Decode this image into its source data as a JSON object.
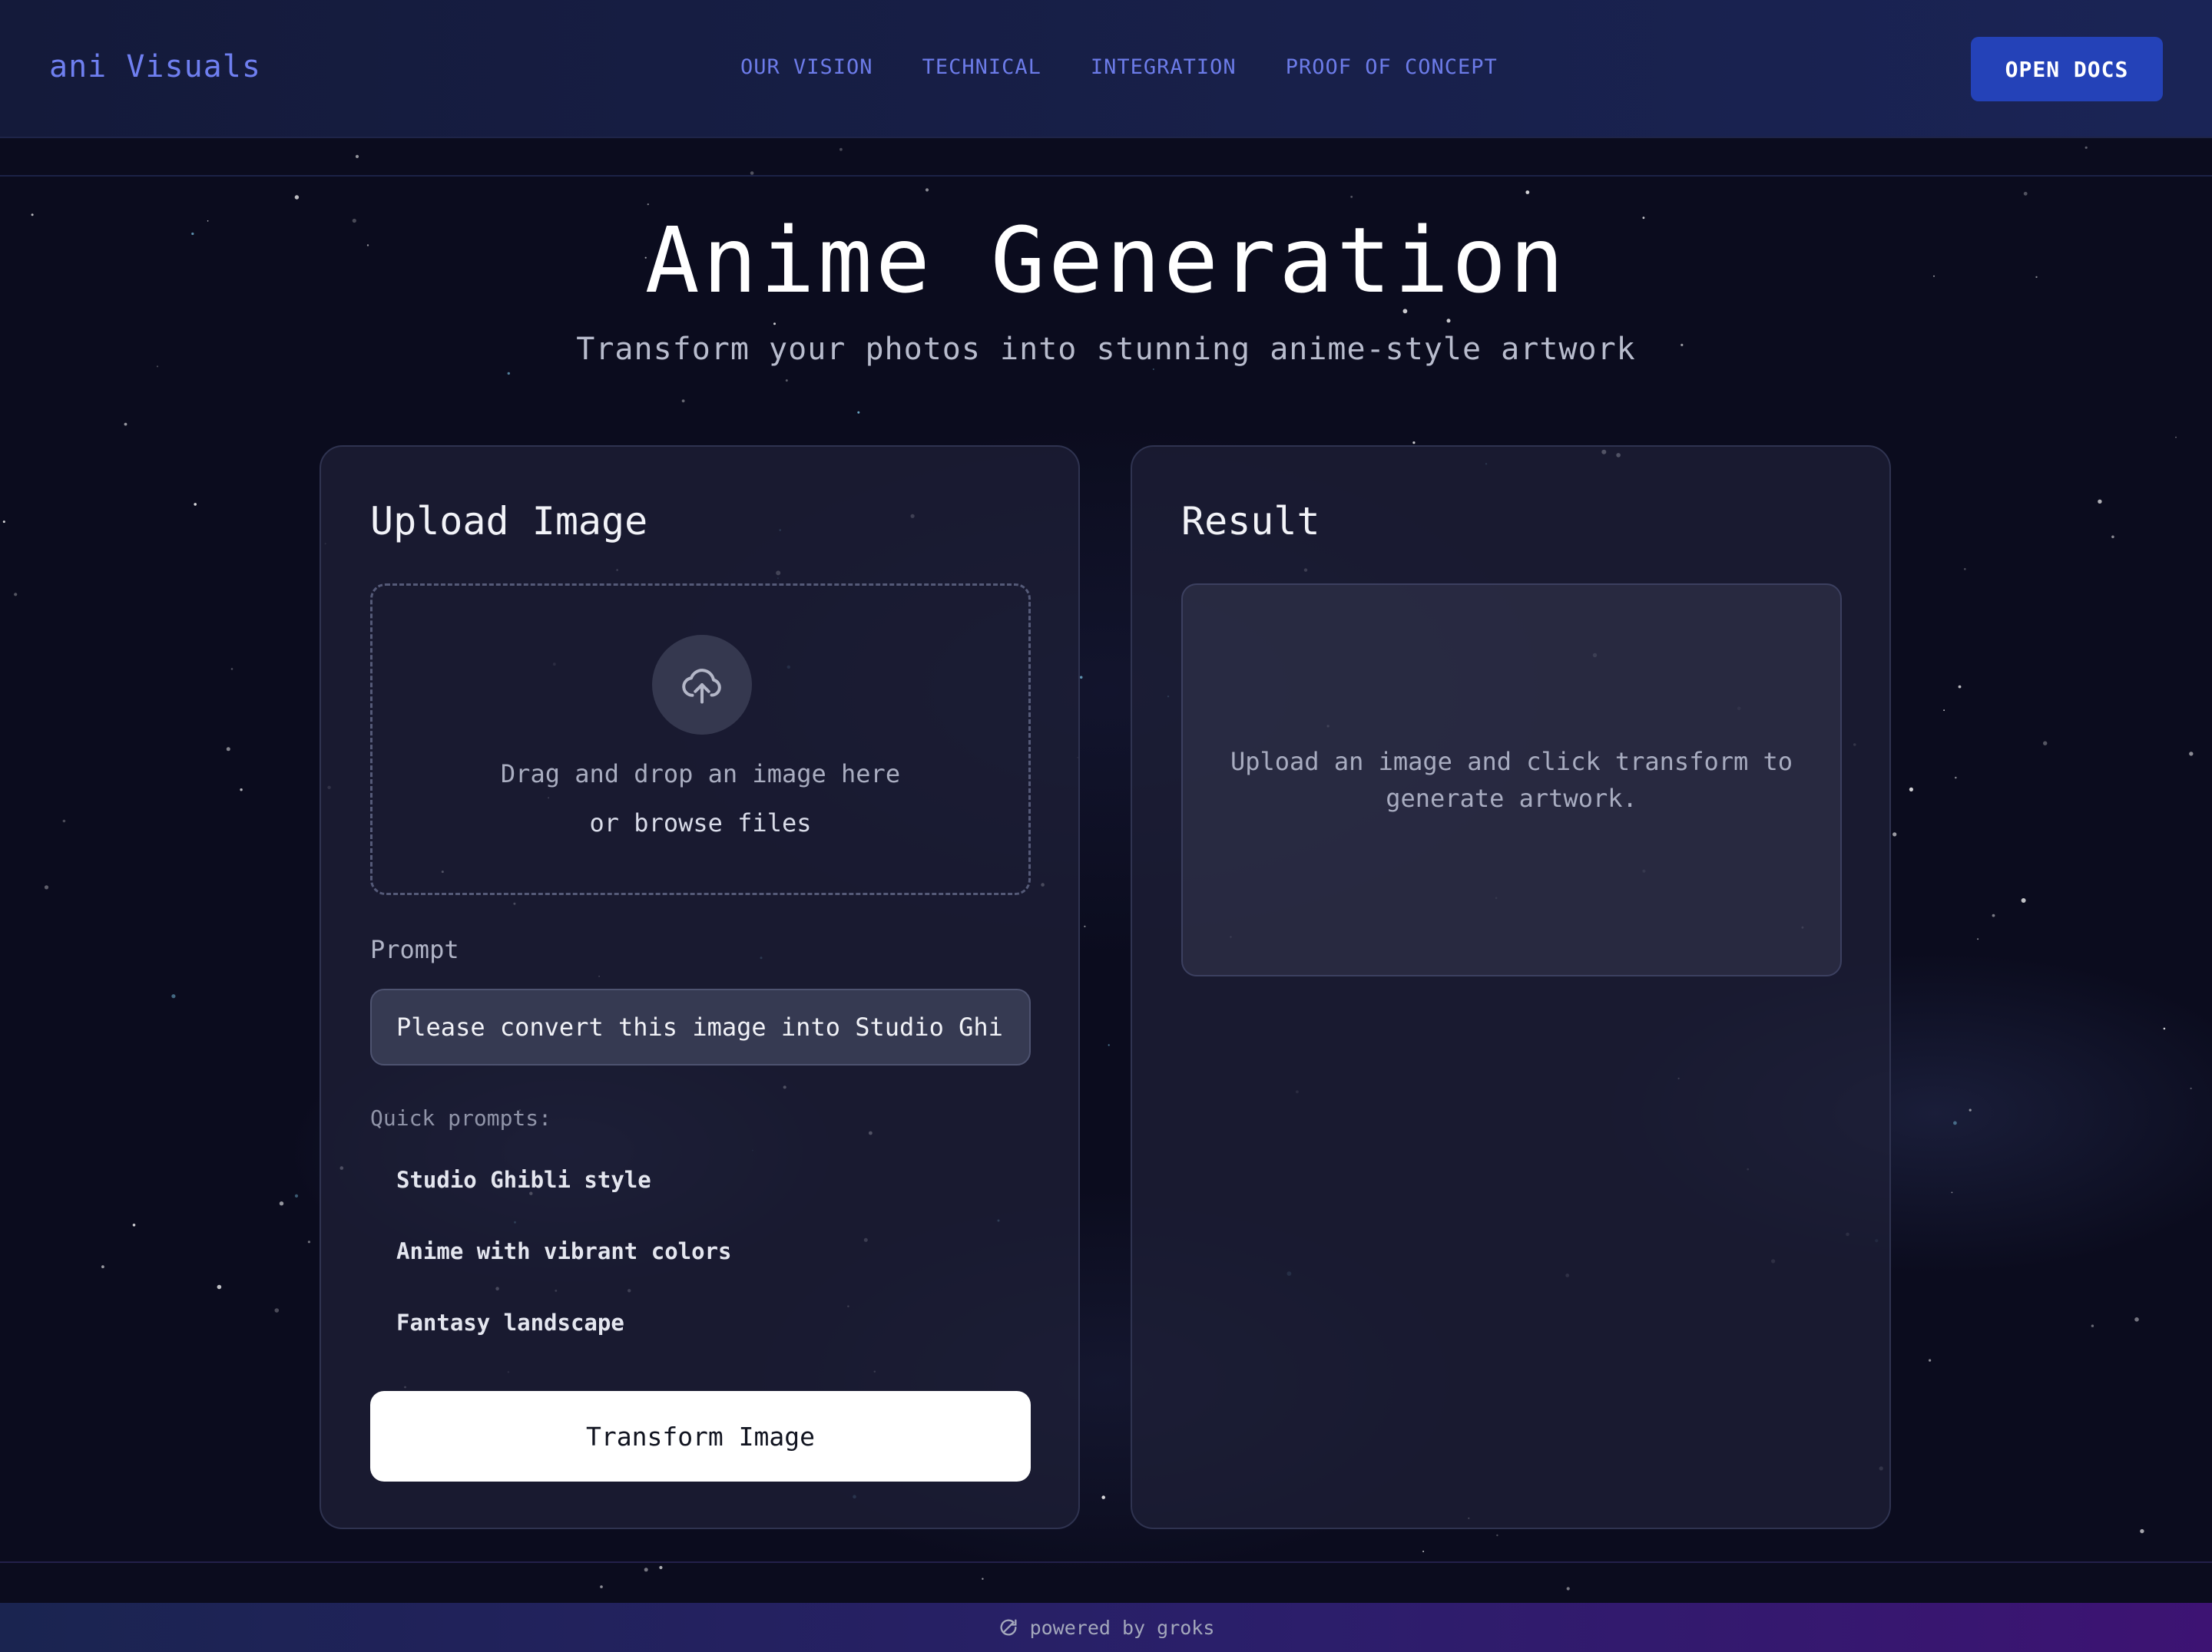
{
  "header": {
    "brand": "ani Visuals",
    "nav": [
      {
        "label": "OUR VISION"
      },
      {
        "label": "TECHNICAL"
      },
      {
        "label": "INTEGRATION"
      },
      {
        "label": "PROOF OF CONCEPT"
      }
    ],
    "docs_button": "OPEN DOCS"
  },
  "hero": {
    "title": "Anime Generation",
    "subtitle": "Transform your photos into stunning anime-style artwork"
  },
  "upload_panel": {
    "title": "Upload Image",
    "drop_text": "Drag and drop an image here",
    "browse_text": "or browse files",
    "prompt_label": "Prompt",
    "prompt_value": "Please convert this image into Studio Ghibli style",
    "quick_label": "Quick prompts:",
    "quick_prompts": [
      "Studio Ghibli style",
      "Anime with vibrant colors",
      "Fantasy landscape"
    ],
    "transform_button": "Transform Image"
  },
  "result_panel": {
    "title": "Result",
    "placeholder": "Upload an image and click transform to generate artwork."
  },
  "footer": {
    "powered_by": "powered by groks"
  },
  "colors": {
    "accent": "#6c7be8",
    "docs_button": "#2442b8",
    "background": "#0b0c1e"
  },
  "icons": {
    "upload": "cloud-upload-icon",
    "footer": "refresh-icon"
  }
}
